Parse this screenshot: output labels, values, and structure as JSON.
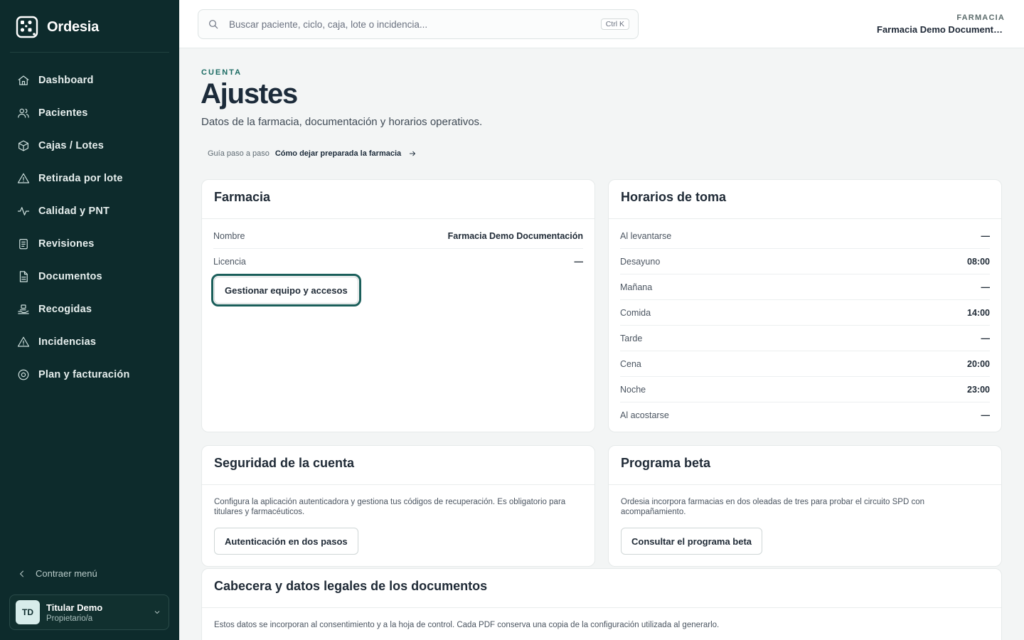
{
  "app": {
    "name": "Ordesia",
    "logo_icon": "grid-pill-icon"
  },
  "sidebar": {
    "items": [
      {
        "label": "Dashboard",
        "icon": "home-icon"
      },
      {
        "label": "Pacientes",
        "icon": "users-icon"
      },
      {
        "label": "Cajas / Lotes",
        "icon": "box-icon"
      },
      {
        "label": "Retirada por lote",
        "icon": "warning-icon"
      },
      {
        "label": "Calidad y PNT",
        "icon": "activity-icon"
      },
      {
        "label": "Revisiones",
        "icon": "clipboard-icon"
      },
      {
        "label": "Documentos",
        "icon": "document-icon"
      },
      {
        "label": "Recogidas",
        "icon": "hand-package-icon"
      },
      {
        "label": "Incidencias",
        "icon": "warning-icon"
      },
      {
        "label": "Plan y facturación",
        "icon": "settings-circle-icon"
      }
    ],
    "collapse_label": "Contraer menú",
    "user": {
      "initials": "TD",
      "name": "Titular Demo",
      "role": "Propietario/a"
    }
  },
  "topbar": {
    "search_placeholder": "Buscar paciente, ciclo, caja, lote o incidencia...",
    "shortcut": "Ctrl K",
    "tenant_label": "FARMACIA",
    "tenant_name": "Farmacia Demo Documentación"
  },
  "header": {
    "eyebrow": "CUENTA",
    "title": "Ajustes",
    "subtitle": "Datos de la farmacia, documentación y horarios operativos.",
    "guide_label": "Guía paso a paso",
    "guide_link": "Cómo dejar preparada la farmacia"
  },
  "farmacia": {
    "title": "Farmacia",
    "rows": [
      {
        "label": "Nombre",
        "value": "Farmacia Demo Documentación"
      },
      {
        "label": "Licencia",
        "value": "—"
      }
    ],
    "button": "Gestionar equipo y accesos"
  },
  "horarios": {
    "title": "Horarios de toma",
    "rows": [
      {
        "label": "Al levantarse",
        "value": "—"
      },
      {
        "label": "Desayuno",
        "value": "08:00"
      },
      {
        "label": "Mañana",
        "value": "—"
      },
      {
        "label": "Comida",
        "value": "14:00"
      },
      {
        "label": "Tarde",
        "value": "—"
      },
      {
        "label": "Cena",
        "value": "20:00"
      },
      {
        "label": "Noche",
        "value": "23:00"
      },
      {
        "label": "Al acostarse",
        "value": "—"
      }
    ]
  },
  "seguridad": {
    "title": "Seguridad de la cuenta",
    "text": "Configura la aplicación autenticadora y gestiona tus códigos de recuperación. Es obligatorio para titulares y farmacéuticos.",
    "button": "Autenticación en dos pasos"
  },
  "beta": {
    "title": "Programa beta",
    "text": "Ordesia incorpora farmacias en dos oleadas de tres para probar el circuito SPD con acompañamiento.",
    "button": "Consultar el programa beta"
  },
  "cabecera": {
    "title": "Cabecera y datos legales de los documentos",
    "text": "Estos datos se incorporan al consentimiento y a la hoja de control. Cada PDF conserva una copia de la configuración utilizada al generarlo."
  },
  "colors": {
    "sidebar_bg": "#0d2b2c",
    "accent": "#1b6b63",
    "page_bg": "#f3f5f5"
  }
}
